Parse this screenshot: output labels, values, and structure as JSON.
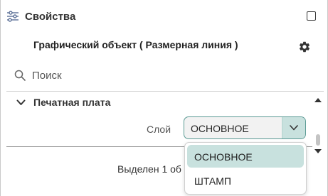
{
  "panel": {
    "title": "Свойства",
    "object_title": "Графический объект ( Размерная линия )"
  },
  "search": {
    "placeholder": "Поиск"
  },
  "group": {
    "label": "Печатная плата",
    "expanded": true
  },
  "property": {
    "label": "Слой",
    "value": "ОСНОВНОЕ"
  },
  "dropdown": {
    "options": [
      "ОСНОВНОЕ",
      "ШТАМП"
    ],
    "selected": "ОСНОВНОЕ"
  },
  "status": {
    "text": "Выделен 1 об"
  },
  "colors": {
    "accent": "#c8e1de",
    "accent_border": "#5a9a94"
  },
  "icons": {
    "title": "sliders-icon",
    "maximize": "square-icon",
    "settings": "gear-icon",
    "search": "magnifier-icon",
    "group": "chevron-down-icon",
    "select": "chevron-down-icon"
  }
}
